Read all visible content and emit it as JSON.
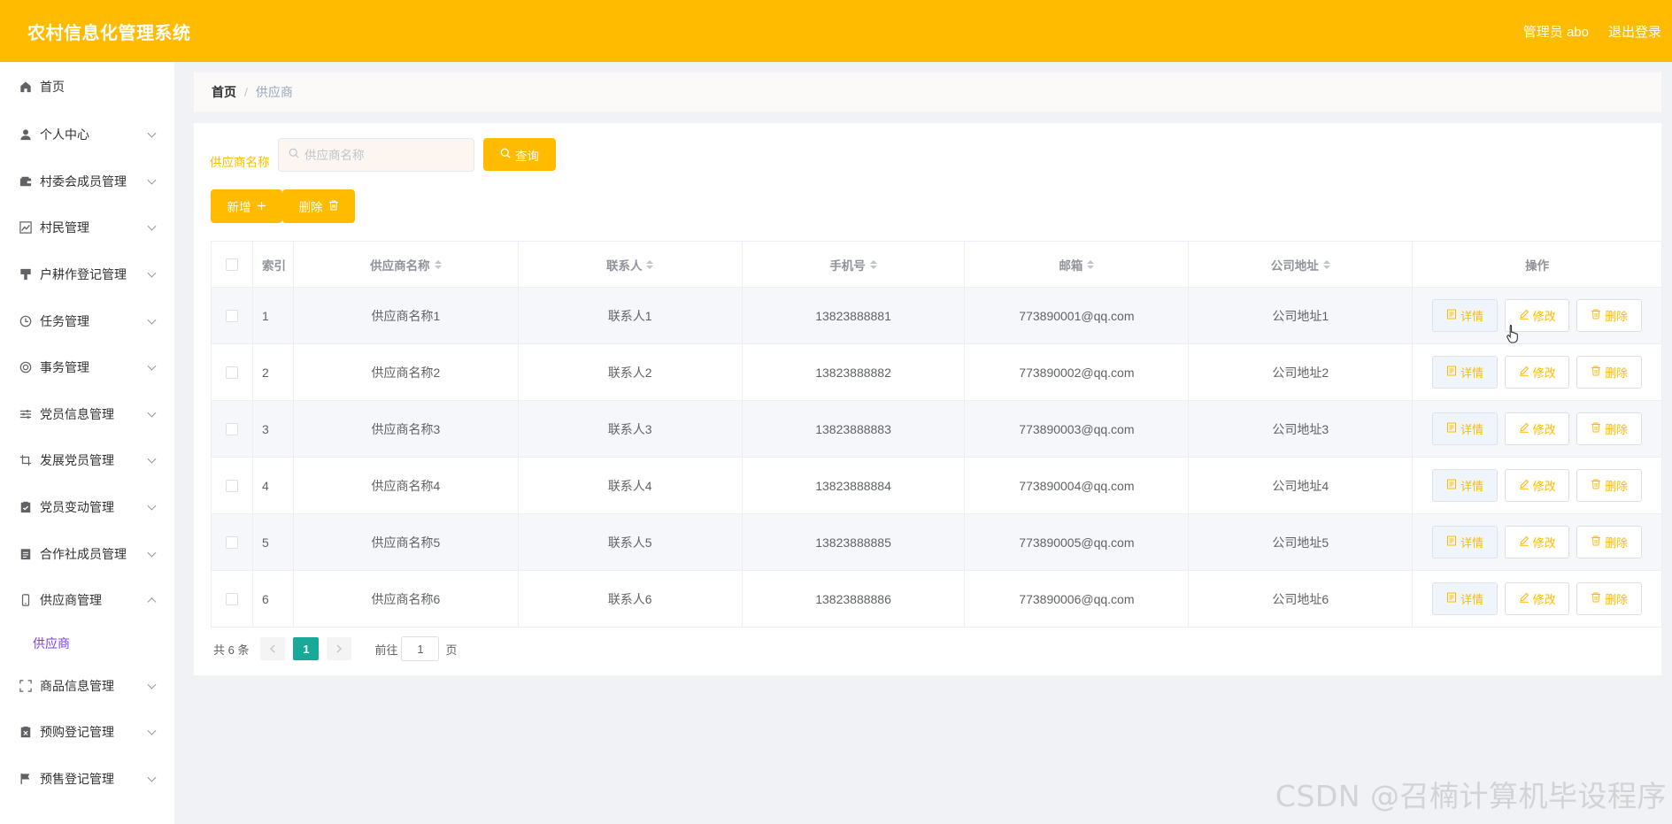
{
  "header": {
    "app_title": "农村信息化管理系统",
    "user_label": "管理员 abo",
    "logout_label": "退出登录"
  },
  "sidebar": {
    "items": [
      {
        "label": "首页",
        "icon": "home-icon"
      },
      {
        "label": "个人中心",
        "icon": "user-icon"
      },
      {
        "label": "村委会成员管理",
        "icon": "wallet-icon"
      },
      {
        "label": "村民管理",
        "icon": "chart-icon"
      },
      {
        "label": "户耕作登记管理",
        "icon": "cabinet-icon"
      },
      {
        "label": "任务管理",
        "icon": "clock-icon"
      },
      {
        "label": "事务管理",
        "icon": "lifebuoy-icon"
      },
      {
        "label": "党员信息管理",
        "icon": "sliders-icon"
      },
      {
        "label": "发展党员管理",
        "icon": "crop-icon"
      },
      {
        "label": "党员变动管理",
        "icon": "clipboard-check-icon"
      },
      {
        "label": "合作社成员管理",
        "icon": "document-icon"
      },
      {
        "label": "供应商管理",
        "icon": "phone-icon"
      },
      {
        "label": "商品信息管理",
        "icon": "fullscreen-icon"
      },
      {
        "label": "预购登记管理",
        "icon": "clipboard-x-icon"
      },
      {
        "label": "预售登记管理",
        "icon": "flag-icon"
      }
    ],
    "active_submenu": "供应商"
  },
  "breadcrumb": {
    "home": "首页",
    "separator": "/",
    "current": "供应商"
  },
  "search": {
    "label": "供应商名称",
    "placeholder": "供应商名称",
    "query_label": "查询"
  },
  "actions": {
    "add_label": "新增",
    "delete_label": "删除"
  },
  "table": {
    "columns": {
      "index": "索引",
      "name": "供应商名称",
      "contact": "联系人",
      "phone": "手机号",
      "email": "邮箱",
      "address": "公司地址",
      "ops": "操作"
    },
    "op_labels": {
      "detail": "详情",
      "edit": "修改",
      "delete": "删除"
    },
    "rows": [
      {
        "index": "1",
        "name": "供应商名称1",
        "contact": "联系人1",
        "phone": "13823888881",
        "email": "773890001@qq.com",
        "address": "公司地址1"
      },
      {
        "index": "2",
        "name": "供应商名称2",
        "contact": "联系人2",
        "phone": "13823888882",
        "email": "773890002@qq.com",
        "address": "公司地址2"
      },
      {
        "index": "3",
        "name": "供应商名称3",
        "contact": "联系人3",
        "phone": "13823888883",
        "email": "773890003@qq.com",
        "address": "公司地址3"
      },
      {
        "index": "4",
        "name": "供应商名称4",
        "contact": "联系人4",
        "phone": "13823888884",
        "email": "773890004@qq.com",
        "address": "公司地址4"
      },
      {
        "index": "5",
        "name": "供应商名称5",
        "contact": "联系人5",
        "phone": "13823888885",
        "email": "773890005@qq.com",
        "address": "公司地址5"
      },
      {
        "index": "6",
        "name": "供应商名称6",
        "contact": "联系人6",
        "phone": "13823888886",
        "email": "773890006@qq.com",
        "address": "公司地址6"
      }
    ]
  },
  "pagination": {
    "total_text": "共 6 条",
    "current_page": "1",
    "goto_label": "前往",
    "goto_value": "1",
    "page_suffix": "页"
  },
  "watermark": "CSDN @召楠计算机毕设程序",
  "colors": {
    "primary": "#ffbb00",
    "active_menu": "#7e3ff2",
    "pager_active": "#18a999"
  }
}
